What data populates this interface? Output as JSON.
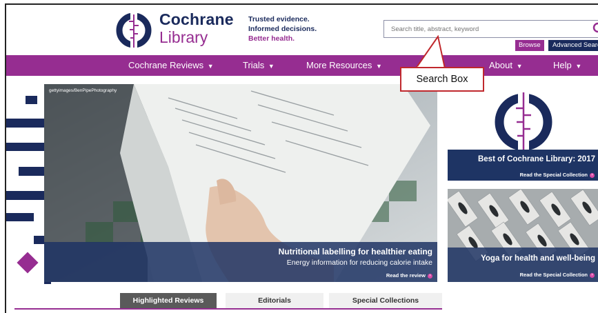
{
  "brand": {
    "logo_line1": "Cochrane",
    "logo_line2": "Library",
    "tagline_1": "Trusted evidence.",
    "tagline_2": "Informed decisions.",
    "tagline_3": "Better health.",
    "navy": "#1a2a5c",
    "purple": "#962d91"
  },
  "search": {
    "placeholder": "Search title, abstract, keyword",
    "icon": "search-icon",
    "browse_label": "Browse",
    "advanced_label": "Advanced Search"
  },
  "nav": {
    "items": [
      {
        "label": "Cochrane Reviews",
        "caret": "▼"
      },
      {
        "label": "Trials",
        "caret": "▼"
      },
      {
        "label": "More Resources",
        "caret": "▼"
      },
      {
        "label": "About",
        "caret": "▼"
      },
      {
        "label": "Help",
        "caret": "▼"
      }
    ]
  },
  "callout": {
    "label": "Search Box",
    "color": "#c0282d"
  },
  "hero": {
    "credit": "gettyimages/BenPipePhotography",
    "title": "Nutritional labelling for healthier eating",
    "subtitle": "Energy information for reducing calorie intake",
    "link": "Read the review"
  },
  "cards": [
    {
      "title": "Best of Cochrane Library: 2017",
      "link": "Read the Special Collection"
    },
    {
      "title": "Yoga for health and well-being",
      "link": "Read the Special Collection"
    }
  ],
  "tabs": [
    {
      "label": "Highlighted Reviews",
      "active": true
    },
    {
      "label": "Editorials",
      "active": false
    },
    {
      "label": "Special Collections",
      "active": false
    }
  ]
}
